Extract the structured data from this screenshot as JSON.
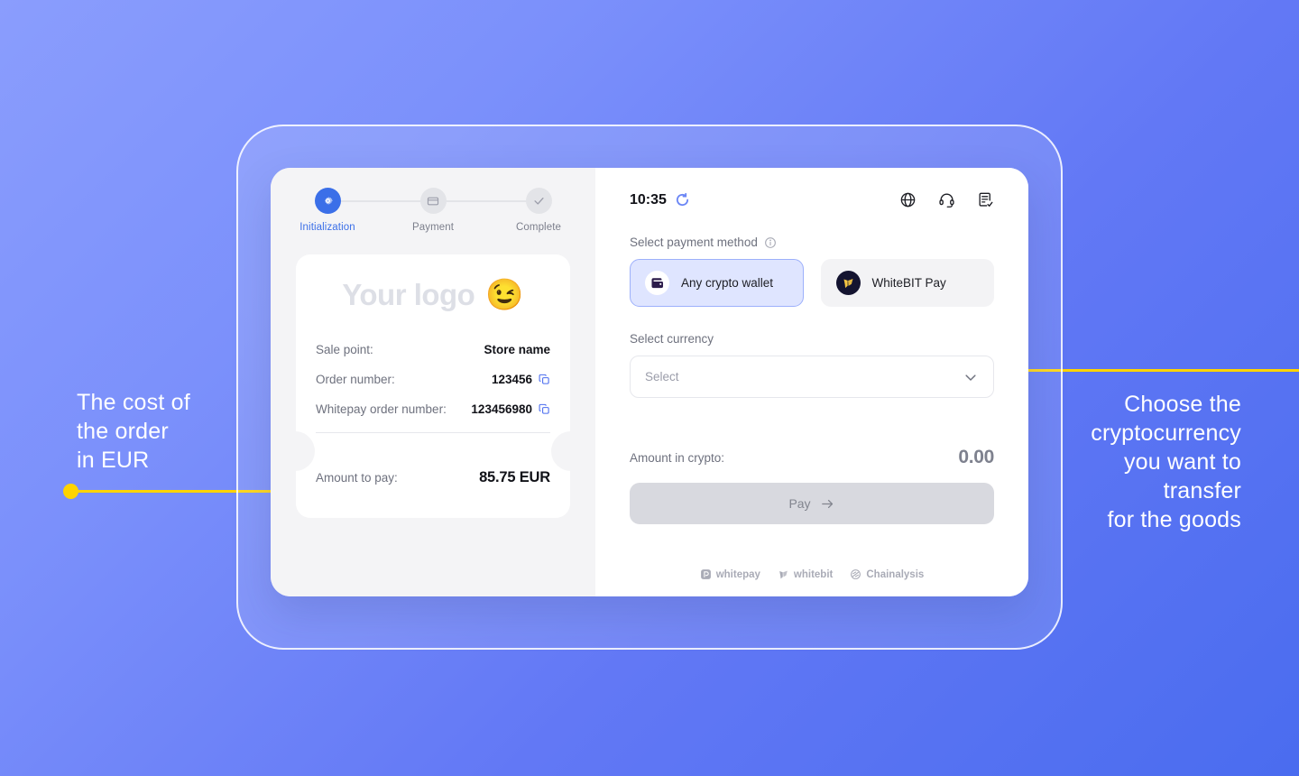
{
  "background": {
    "from": "#8a9dfd",
    "to": "#4a6cef",
    "accent": "#ffd400"
  },
  "annotations": {
    "left": {
      "text": "The cost of\nthe order\nin EUR",
      "name": "annotation-left"
    },
    "right": {
      "text": "Choose the\ncryptocurrency\nyou want to\ntransfer\nfor the goods",
      "name": "annotation-right"
    }
  },
  "stepper": {
    "steps": [
      {
        "label": "Initialization",
        "icon": "gear-icon",
        "state": "active"
      },
      {
        "label": "Payment",
        "icon": "credit-card-icon",
        "state": "upcoming"
      },
      {
        "label": "Complete",
        "icon": "check-icon",
        "state": "upcoming"
      }
    ]
  },
  "receipt": {
    "logo_text": "Your logo",
    "logo_emoji": "😉",
    "rows": [
      {
        "key": "Sale point:",
        "value": "Store name",
        "copy": false
      },
      {
        "key": "Order number:",
        "value": "123456",
        "copy": true
      },
      {
        "key": "Whitepay order number:",
        "value": "123456980",
        "copy": true
      }
    ],
    "total_key": "Amount to pay:",
    "total_value": "85.75 EUR"
  },
  "panel": {
    "timer": "10:35",
    "timer_icon": "refresh-spinner-icon",
    "head_icons": [
      {
        "name": "globe-icon"
      },
      {
        "name": "headset-support-icon"
      },
      {
        "name": "document-check-icon"
      }
    ],
    "payment_method_label": "Select payment method",
    "payment_method_info_icon": "info-icon",
    "methods": [
      {
        "label": "Any crypto wallet",
        "icon": "wallet-icon",
        "selected": true
      },
      {
        "label": "WhiteBIT Pay",
        "icon": "whitebit-icon",
        "selected": false
      }
    ],
    "currency_label": "Select currency",
    "currency_placeholder": "Select",
    "currency_chevron_icon": "chevron-down-icon",
    "crypto_amount_label": "Amount in crypto:",
    "crypto_amount_value": "0.00",
    "pay_label": "Pay",
    "pay_arrow_icon": "arrow-right-icon",
    "footer": [
      {
        "label": "whitepay",
        "icon": "whitepay-logo-icon"
      },
      {
        "label": "whitebit",
        "icon": "whitebit-logo-icon"
      },
      {
        "label": "Chainalysis",
        "icon": "chainalysis-logo-icon"
      }
    ]
  }
}
